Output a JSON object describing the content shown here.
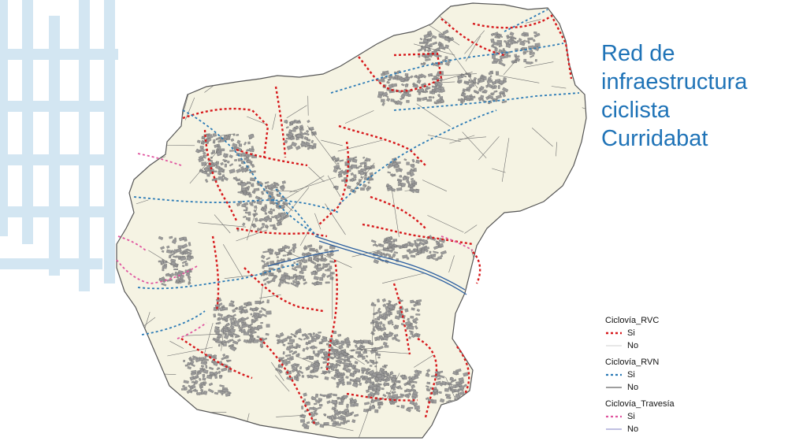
{
  "title_lines": [
    "Red de",
    "infraestructura",
    "ciclista",
    "Curridabat"
  ],
  "colors": {
    "title": "#1f73b7",
    "map_fill": "#f5f3e3",
    "map_border": "#555555",
    "blocks": "#9a9a9a",
    "rvc": "#d7191c",
    "rvn": "#2c7bb6",
    "travesia": "#e0559f",
    "grid_deco": "#d3e6f2"
  },
  "legend": {
    "groups": [
      {
        "title": "Ciclovía_RVC",
        "items": [
          {
            "label": "Si",
            "style": "dashed",
            "color": "#d7191c"
          },
          {
            "label": "No",
            "style": "solid",
            "color": "#cfcfcf"
          }
        ]
      },
      {
        "title": "Ciclovía_RVN",
        "items": [
          {
            "label": "Si",
            "style": "dashed",
            "color": "#2c7bb6"
          },
          {
            "label": "No",
            "style": "solid",
            "color": "#7f7f7f"
          }
        ]
      },
      {
        "title": "Ciclovía_Travesía",
        "items": [
          {
            "label": "Si",
            "style": "dashed",
            "color": "#e0559f"
          },
          {
            "label": "No",
            "style": "solid",
            "color": "#9a9acf"
          }
        ]
      }
    ]
  }
}
